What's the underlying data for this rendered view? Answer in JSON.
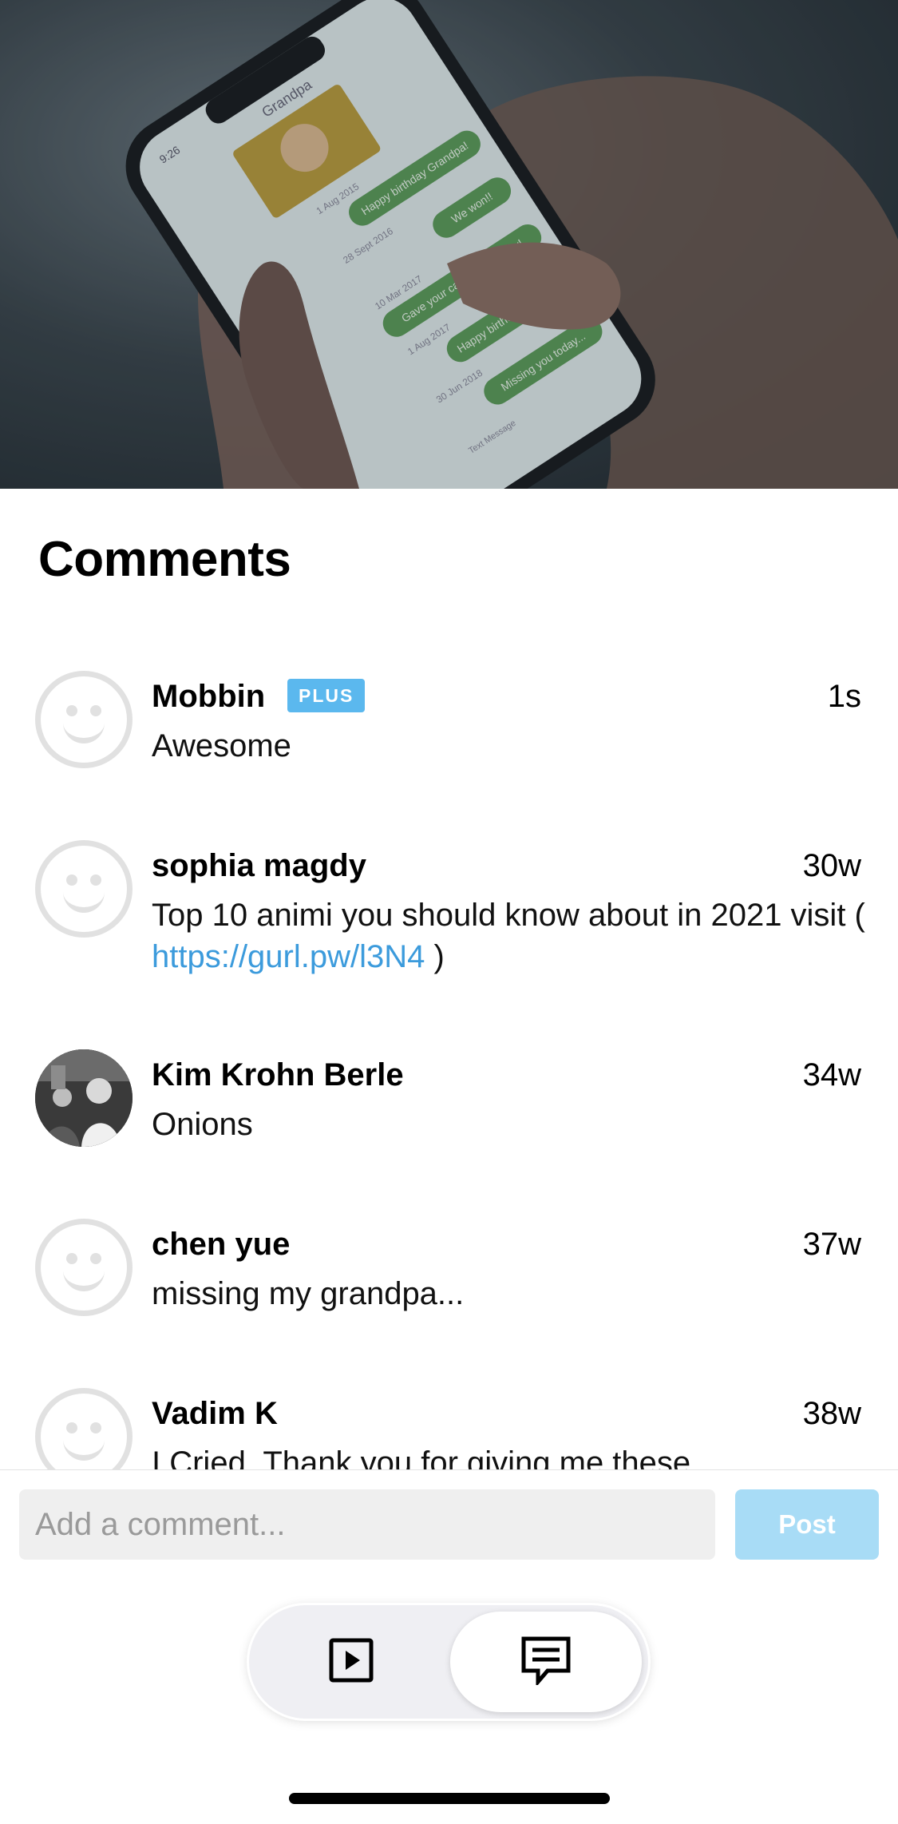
{
  "screen": {
    "title": "Comments"
  },
  "hero": {
    "image_description": "Hands holding a phone showing a message thread",
    "phone_screen": {
      "status_time": "9:26",
      "contact": "Grandpa",
      "messages": [
        {
          "date": "1 Aug 2015",
          "text": "Happy birthday Grandpa!"
        },
        {
          "date": "28 Sept 2016",
          "text": "We won!!"
        },
        {
          "date": "10 Mar 2017",
          "text": "Gave your car a wash today!"
        },
        {
          "date": "1 Aug 2017",
          "text": "Happy birthday Grandpa"
        },
        {
          "date": "30 Jun 2018",
          "text": "Missing you today..."
        }
      ],
      "footer": "Text Message"
    }
  },
  "comments": [
    {
      "name": "Mobbin",
      "badge": "PLUS",
      "time": "1s",
      "text": "Awesome",
      "avatar": "placeholder"
    },
    {
      "name": "sophia magdy",
      "time": "30w",
      "text": "Top 10 animi you should know about in 2021 visit ( ",
      "link": "https://gurl.pw/l3N4",
      "text_after": " )",
      "avatar": "placeholder"
    },
    {
      "name": "Kim Krohn Berle",
      "time": "34w",
      "text": "Onions",
      "avatar": "photo"
    },
    {
      "name": "chen yue",
      "time": "37w",
      "text": "missing my grandpa...",
      "avatar": "placeholder"
    },
    {
      "name": "Vadim K",
      "time": "38w",
      "text": "I Cried. Thank you for giving me these",
      "avatar": "placeholder"
    }
  ],
  "composer": {
    "placeholder": "Add a comment...",
    "post_label": "Post"
  },
  "segmented_control": {
    "options": [
      {
        "label": "video",
        "icon": "play-square-icon",
        "selected": false
      },
      {
        "label": "comments",
        "icon": "comment-lines-icon",
        "selected": true
      }
    ]
  },
  "colors": {
    "badge": "#5bb8ee",
    "link": "#3c9bdc",
    "post_button_disabled": "#a8dcf6",
    "avatar_placeholder": "#e1e1e1"
  }
}
